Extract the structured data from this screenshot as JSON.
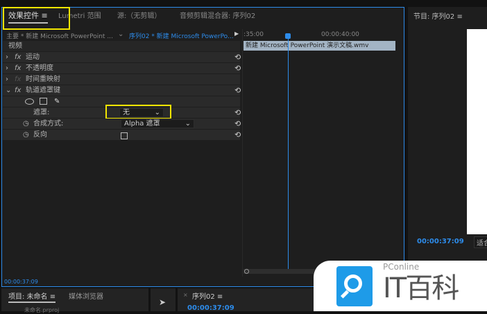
{
  "tabs": [
    {
      "label": "效果控件",
      "active": true
    },
    {
      "label": "Lumetri 范围"
    },
    {
      "label": "源:（无剪辑）"
    },
    {
      "label": "音频剪辑混合器: 序列02"
    }
  ],
  "effect_controls": {
    "master_clip": "主要 * 新建 Microsoft PowerPoint ...",
    "sequence_clip": "序列02 * 新建 Microsoft PowerPo...",
    "section": "视频",
    "effects": [
      {
        "label": "运动"
      },
      {
        "label": "不透明度"
      },
      {
        "label": "时间重映射"
      },
      {
        "label": "轨道遮罩键"
      }
    ],
    "mask_label": "遮罩:",
    "mask_value": "无",
    "composite_label": "合成方式:",
    "composite_value": "Alpha 遮罩",
    "reverse_label": "反向",
    "timecode": "00:00:37:09"
  },
  "timeline": {
    "ruler_start": ":35:00",
    "ruler_mark": "00:00:40:00",
    "clip_name": "新建 Microsoft PowerPoint 演示文稿.wmv"
  },
  "program": {
    "title": "节目: 序列02",
    "timecode": "00:00:37:09",
    "fit": "适合"
  },
  "bottom": {
    "project_tab": "项目: 未命名",
    "media_tab": "媒体浏览器",
    "project_item": "未命名.prproj",
    "sequence_tab": "序列02",
    "sequence_timecode": "00:00:37:09"
  },
  "watermark": {
    "brand": "PConline",
    "name": "IT百科"
  },
  "colors": {
    "accent": "#2d8ceb",
    "highlight": "#f2e600"
  }
}
